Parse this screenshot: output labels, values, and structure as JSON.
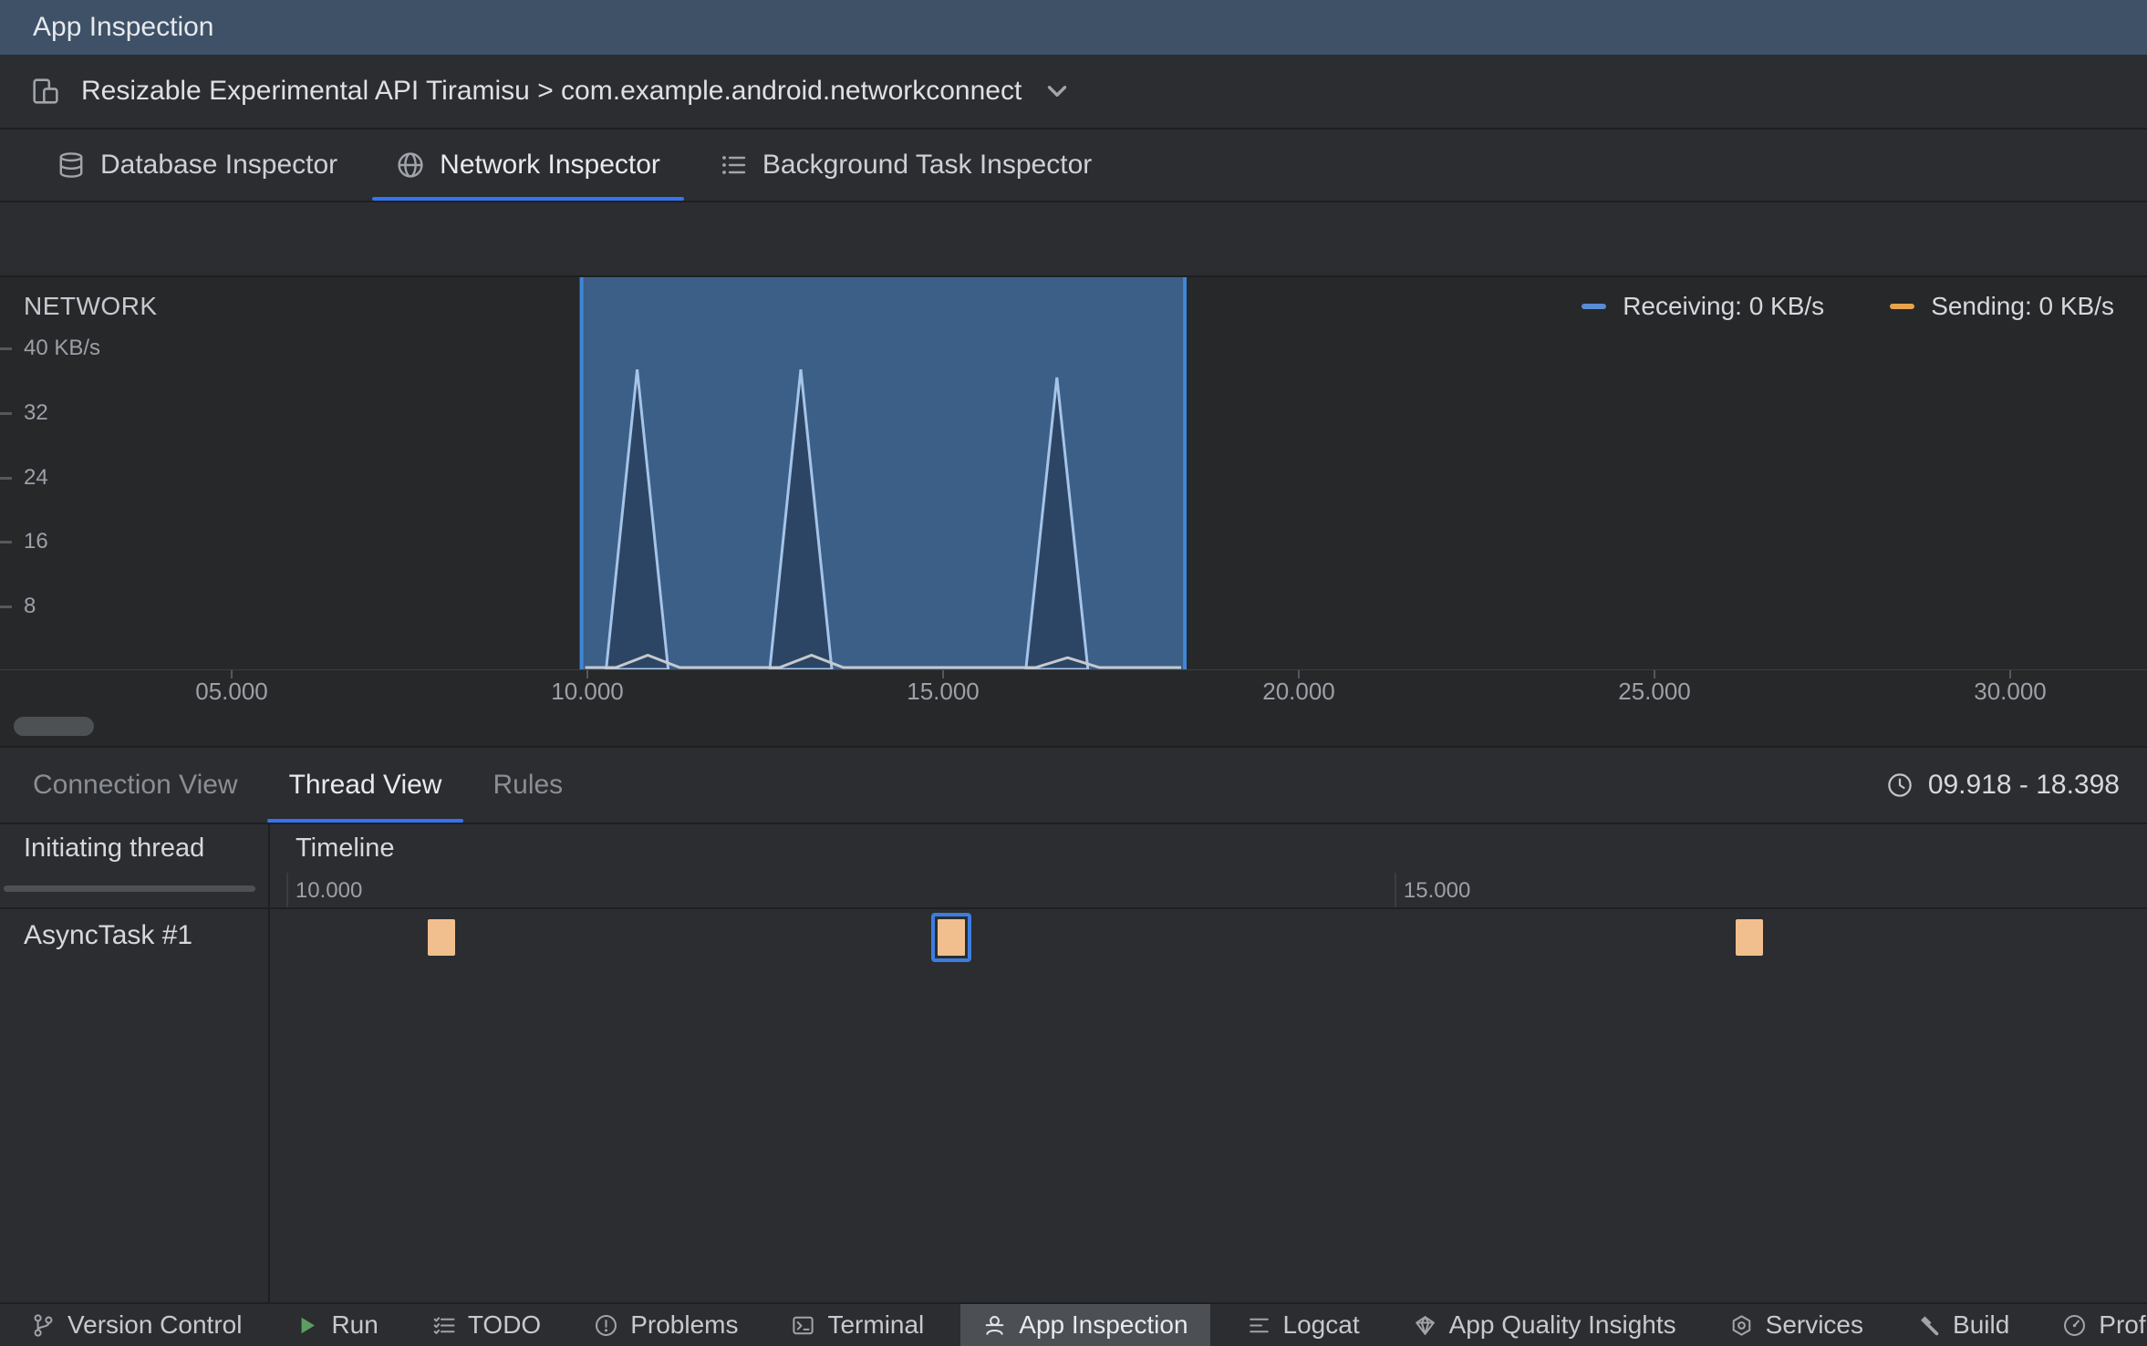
{
  "titlebar": {
    "title": "App Inspection"
  },
  "device_bar": {
    "label": "Resizable Experimental API Tiramisu > com.example.android.networkconnect"
  },
  "inspector_tabs": {
    "database": "Database Inspector",
    "network": "Network Inspector",
    "background": "Background Task Inspector"
  },
  "chart_data": {
    "type": "area",
    "title": "NETWORK",
    "unit": "KB/s",
    "y_ticks": [
      {
        "label": "40 KB/s",
        "value": 40
      },
      {
        "label": "32",
        "value": 32
      },
      {
        "label": "24",
        "value": 24
      },
      {
        "label": "16",
        "value": 16
      },
      {
        "label": "8",
        "value": 8
      }
    ],
    "x_ticks": [
      {
        "label": "05.000",
        "t": 5
      },
      {
        "label": "10.000",
        "t": 10
      },
      {
        "label": "15.000",
        "t": 15
      },
      {
        "label": "20.000",
        "t": 20
      },
      {
        "label": "25.000",
        "t": 25
      },
      {
        "label": "30.000",
        "t": 30
      }
    ],
    "legend": [
      {
        "label": "Receiving: 0 KB/s",
        "color": "#5A8BD6"
      },
      {
        "label": "Sending: 0 KB/s",
        "color": "#E8A34D"
      }
    ],
    "selection": {
      "start_t": 9.918,
      "end_t": 18.398,
      "fill": "#3B5F86",
      "edge": "#3F87D7"
    },
    "series": [
      {
        "name": "Receiving",
        "fill": "#2C4564",
        "stroke": "#A5C4E8",
        "spikes": [
          {
            "t": 10.7,
            "peak": 37.5
          },
          {
            "t": 13.0,
            "peak": 37.5
          },
          {
            "t": 16.6,
            "peak": 36.5
          }
        ]
      },
      {
        "name": "Sending",
        "stroke": "#C6C9CD",
        "bumps": [
          {
            "t": 10.85,
            "peak": 1.5
          },
          {
            "t": 13.15,
            "peak": 1.5
          },
          {
            "t": 16.75,
            "peak": 1.2
          }
        ]
      }
    ]
  },
  "detail_tabs": {
    "connection": "Connection View",
    "thread": "Thread View",
    "rules": "Rules"
  },
  "time_range": "09.918 - 18.398",
  "thread_table": {
    "col_thread": "Initiating thread",
    "col_timeline": "Timeline",
    "ruler_ticks": [
      {
        "label": "10.000",
        "t": 10
      },
      {
        "label": "15.000",
        "t": 15
      }
    ],
    "rows": [
      {
        "thread": "AsyncTask #1",
        "events": [
          {
            "t": 10.7,
            "selected": false
          },
          {
            "t": 13.0,
            "selected": true
          },
          {
            "t": 16.6,
            "selected": false
          }
        ]
      }
    ]
  },
  "status_bar": [
    {
      "label": "Version Control",
      "icon": "branch-icon",
      "active": false
    },
    {
      "label": "Run",
      "icon": "run-icon",
      "active": false
    },
    {
      "label": "TODO",
      "icon": "todo-icon",
      "active": false
    },
    {
      "label": "Problems",
      "icon": "problems-icon",
      "active": false
    },
    {
      "label": "Terminal",
      "icon": "terminal-icon",
      "active": false
    },
    {
      "label": "App Inspection",
      "icon": "spy-icon",
      "active": true
    },
    {
      "label": "Logcat",
      "icon": "logcat-icon",
      "active": false
    },
    {
      "label": "App Quality Insights",
      "icon": "diamond-icon",
      "active": false
    },
    {
      "label": "Services",
      "icon": "services-icon",
      "active": false
    },
    {
      "label": "Build",
      "icon": "hammer-icon",
      "active": false
    },
    {
      "label": "Profiler",
      "icon": "gauge-icon",
      "active": false
    }
  ],
  "colors": {
    "accent": "#3574F0",
    "event_block": "#F1BF8D",
    "event_selected_border": "#3D7DE0"
  }
}
